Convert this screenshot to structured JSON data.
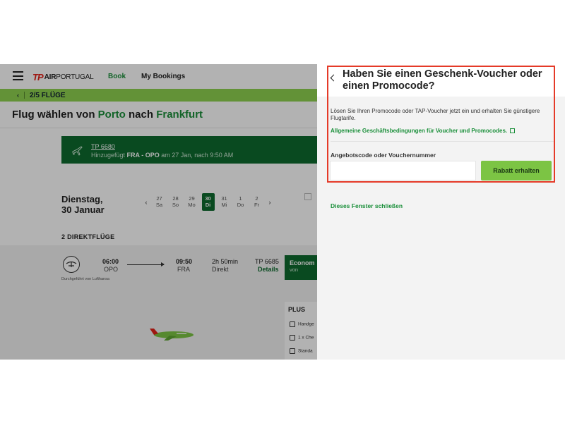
{
  "header": {
    "logo_mark": "TP",
    "logo_air": "AIR",
    "logo_portugal": "PORTUGAL",
    "nav_book": "Book",
    "nav_bookings": "My Bookings"
  },
  "stepbar": {
    "step": "2/5 FLÜGE"
  },
  "flight_title": {
    "prefix": "Flug wählen von ",
    "origin": "Porto",
    "middle": " nach ",
    "destination": "Frankfurt"
  },
  "added_flight": {
    "flight_number": "TP 6680",
    "added_prefix": "Hinzugefügt ",
    "route": "FRA - OPO",
    "added_suffix": " am 27 Jan, nach 9:50 AM"
  },
  "date_selector": {
    "day_name": "Dienstag,",
    "day_date": "30 Januar",
    "dates": [
      {
        "num": "27",
        "day": "Sa"
      },
      {
        "num": "28",
        "day": "So"
      },
      {
        "num": "29",
        "day": "Mo"
      },
      {
        "num": "30",
        "day": "Di"
      },
      {
        "num": "31",
        "day": "Mi"
      },
      {
        "num": "1",
        "day": "Do"
      },
      {
        "num": "2",
        "day": "Fr"
      }
    ],
    "selected_index": 3
  },
  "flights_heading": "2 DIREKTFLÜGE",
  "flight": {
    "operated_by": "Durchgeführt von Lufthansa",
    "dep_time": "06:00",
    "dep_code": "OPO",
    "arr_time": "09:50",
    "arr_code": "FRA",
    "duration": "2h 50min",
    "stops": "Direkt",
    "number": "TP 6685",
    "details": "Details",
    "class_name": "Econom",
    "class_sub": "von"
  },
  "plus_panel": {
    "title": "PLUS",
    "items": [
      "Handge",
      "1 x Che",
      "Standa"
    ]
  },
  "voucher_panel": {
    "title": "Haben Sie einen Geschenk-Voucher oder einen Promocode?",
    "description": "Lösen Sie Ihren Promocode oder TAP-Voucher jetzt ein und erhalten Sie günstigere Flugtarife.",
    "terms_link": "Allgemeine Geschäftsbedingungen für Voucher und Promocodes.",
    "code_label": "Angebotscode oder Vouchernummer",
    "code_value": "",
    "submit_label": "Rabatt erhalten",
    "close_label": "Dieses Fenster schließen"
  },
  "colors": {
    "brand_green": "#0e6b2f",
    "accent_green": "#7cc444",
    "link_green": "#1a8f3a",
    "tap_red": "#e32119",
    "highlight_red": "#e53a28"
  }
}
